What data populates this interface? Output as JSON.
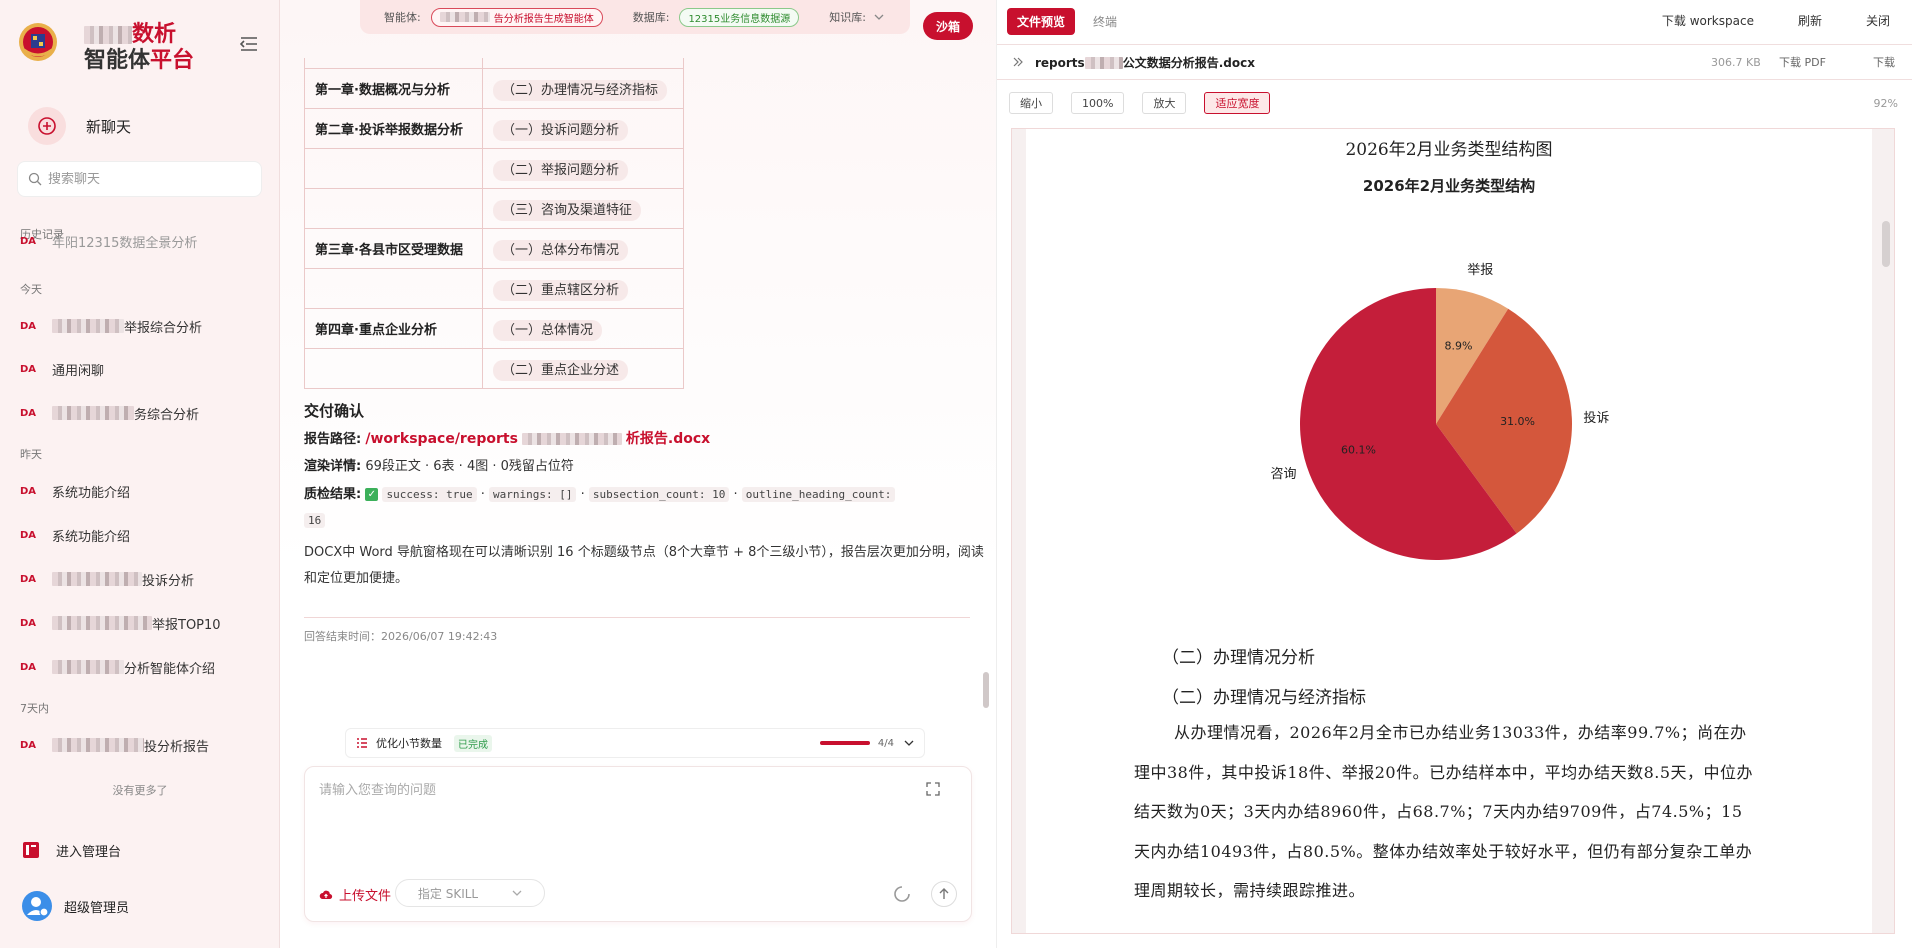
{
  "sidebar": {
    "brand_line1": "数析",
    "brand_line2_a": "智能体",
    "brand_line2_b": "平台",
    "new_chat": "新聊天",
    "search_placeholder": "搜索聊天",
    "history_label": "历史记录",
    "groups": {
      "today": "今天",
      "yesterday": "昨天",
      "week": "7天内"
    },
    "items": [
      {
        "tag": "DA",
        "label": "举报综合分析"
      },
      {
        "tag": "DA",
        "label": "通用闲聊"
      },
      {
        "tag": "DA",
        "label": "务综合分析"
      },
      {
        "tag": "DA",
        "label": "系统功能介绍"
      },
      {
        "tag": "DA",
        "label": "系统功能介绍"
      },
      {
        "tag": "DA",
        "label": "投诉分析"
      },
      {
        "tag": "DA",
        "label": "举报TOP10"
      },
      {
        "tag": "DA",
        "label": "分析智能体介绍"
      },
      {
        "tag": "DA",
        "label": "投分析报告"
      }
    ],
    "cut_item": "年阳12315数据全景分析",
    "no_more": "没有更多了",
    "admin": "进入管理台",
    "user": "超级管理员"
  },
  "chat": {
    "topbar": {
      "agent_label": "智能体:",
      "agent_value": "告分析报告生成智能体",
      "db_label": "数据库:",
      "db_value": "12315业务信息数据源",
      "kb_label": "知识库:"
    },
    "sandbox": "沙箱",
    "outline": [
      {
        "chapter": "第一章·数据概况与分析",
        "section": "（二）办理情况与经济指标"
      },
      {
        "chapter": "第二章·投诉举报数据分析",
        "section": "（一）投诉问题分析"
      },
      {
        "chapter": "",
        "section": "（二）举报问题分析"
      },
      {
        "chapter": "",
        "section": "（三）咨询及渠道特征"
      },
      {
        "chapter": "第三章·各县市区受理数据",
        "section": "（一）总体分布情况"
      },
      {
        "chapter": "",
        "section": "（二）重点辖区分析"
      },
      {
        "chapter": "第四章·重点企业分析",
        "section": "（一）总体情况"
      },
      {
        "chapter": "",
        "section": "（二）重点企业分述"
      }
    ],
    "deliver_title": "交付确认",
    "path_label": "报告路径:",
    "path_a": "/workspace/reports",
    "path_b": "析报告.docx",
    "render_label": "渲染详情:",
    "render_value": "69段正文 · 6表 · 4图 · 0残留占位符",
    "qc_label": "质检结果:",
    "qc_codes": [
      "success: true",
      "warnings: []",
      "subsection_count: 10",
      "outline_heading_count:"
    ],
    "qc_tail": "16",
    "paragraph": "DOCX中 Word 导航窗格现在可以清晰识别 16 个标题级节点（8个大章节 + 8个三级小节），报告层次更加分明，阅读和定位更加便捷。",
    "end_time": "回答结束时间：2026/06/07 19:42:43",
    "task": {
      "label": "优化小节数量",
      "status": "已完成",
      "count": "4/4",
      "progress": 1.0
    },
    "input_placeholder": "请输入您查询的问题",
    "upload": "上传文件",
    "skill": "指定 SKILL"
  },
  "preview": {
    "tab_file": "文件预览",
    "tab_terminal": "终端",
    "act_download_ws": "下载 workspace",
    "act_refresh": "刷新",
    "act_close": "关闭",
    "file_prefix": "reports",
    "file_name": "公文数据分析报告.docx",
    "file_size": "306.7 KB",
    "download_pdf": "下载 PDF",
    "download": "下载",
    "zoom_out": "缩小",
    "zoom_100": "100%",
    "zoom_in": "放大",
    "fit_width": "适应宽度",
    "zoom_pct": "92%",
    "doc": {
      "caption": "2026年2月业务类型结构图",
      "sec_a": "（二）办理情况分析",
      "sec_b": "（二）办理情况与经济指标",
      "body": "从办理情况看，2026年2月全市已办结业务13033件，办结率99.7%；尚在办理中38件，其中投诉18件、举报20件。已办结样本中，平均办结天数8.5天，中位办结天数为0天；3天内办结8960件，占68.7%；7天内办结9709件，占74.5%；15天内办结10493件，占80.5%。整体办结效率处于较好水平，但仍有部分复杂工单办理周期较长，需持续跟踪推进。"
    }
  },
  "chart_data": {
    "type": "pie",
    "title": "2026年2月业务类型结构",
    "categories": [
      "举报",
      "投诉",
      "咨询"
    ],
    "values": [
      8.9,
      31.0,
      60.1
    ],
    "labels": [
      "8.9%",
      "31.0%",
      "60.1%"
    ],
    "colors": [
      "#e8a575",
      "#d4573c",
      "#c41e3a"
    ]
  }
}
